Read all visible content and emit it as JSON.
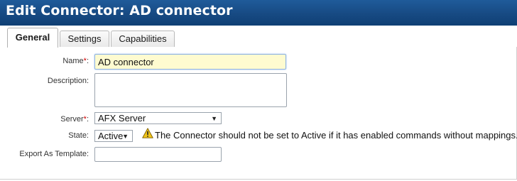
{
  "window": {
    "title": "Edit Connector: AD connector"
  },
  "tabs": [
    {
      "label": "General",
      "active": true
    },
    {
      "label": "Settings",
      "active": false
    },
    {
      "label": "Capabilities",
      "active": false
    }
  ],
  "form": {
    "name": {
      "label": "Name",
      "required_mark": "*",
      "suffix": ":",
      "value": "AD connector"
    },
    "description": {
      "label": "Description:",
      "value": ""
    },
    "server": {
      "label": "Server",
      "required_mark": "*",
      "suffix": ":",
      "value": "AFX Server"
    },
    "state": {
      "label": "State:",
      "value": "Active",
      "warning": "The Connector should not be set to Active if it has enabled commands without mappings.",
      "warning_icon": "warning-triangle-icon"
    },
    "export_as_template": {
      "label": "Export As Template:",
      "value": ""
    }
  },
  "colors": {
    "titlebar": "#174a83",
    "focused_input_bg": "#fefbd0",
    "required": "#d00000",
    "warning_icon": "#f0c419"
  }
}
